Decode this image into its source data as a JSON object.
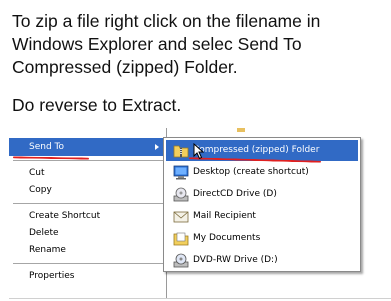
{
  "instructions": {
    "zip_text": "To zip a file right click on the filename in Windows Explorer and selec Send To Compressed (zipped) Folder.",
    "extract_text": "Do reverse to Extract."
  },
  "context_menu": {
    "items": [
      {
        "label": "Send To",
        "highlighted": true,
        "has_submenu": true
      },
      {
        "label": "Cut"
      },
      {
        "label": "Copy"
      },
      {
        "label": "Create Shortcut"
      },
      {
        "label": "Delete"
      },
      {
        "label": "Rename"
      },
      {
        "label": "Properties"
      }
    ]
  },
  "send_to_submenu": {
    "items": [
      {
        "label": "Compressed (zipped) Folder",
        "icon": "zip-folder-icon",
        "highlighted": true
      },
      {
        "label": "Desktop (create shortcut)",
        "icon": "desktop-icon"
      },
      {
        "label": "DirectCD Drive (D)",
        "icon": "cd-drive-icon"
      },
      {
        "label": "Mail Recipient",
        "icon": "mail-envelope-icon"
      },
      {
        "label": "My Documents",
        "icon": "my-documents-folder-icon"
      },
      {
        "label": "DVD-RW Drive (D:)",
        "icon": "dvd-drive-icon"
      }
    ]
  },
  "colors": {
    "selection": "#316ac5",
    "annotation_underline": "#e02020"
  }
}
